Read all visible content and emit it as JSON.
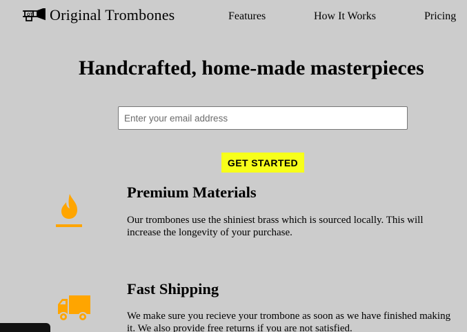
{
  "header": {
    "logo_text": "Original Trombones",
    "logo_icon": "trombone-icon",
    "nav": [
      {
        "label": "Features"
      },
      {
        "label": "How It Works"
      },
      {
        "label": "Pricing"
      }
    ]
  },
  "hero": {
    "title": "Handcrafted, home-made masterpieces",
    "email_placeholder": "Enter your email address",
    "cta_label": "GET STARTED"
  },
  "features": [
    {
      "icon": "fire-icon",
      "title": "Premium Materials",
      "description": "Our trombones use the shiniest brass which is sourced locally. This will increase the longevity of your purchase."
    },
    {
      "icon": "truck-icon",
      "title": "Fast Shipping",
      "description": "We make sure you recieve your trombone as soon as we have finished making it. We also provide free returns if you are not satisfied."
    }
  ],
  "colors": {
    "background": "#cccccc",
    "accent_orange": "#ffa500",
    "cta_yellow": "#f7ff1a"
  }
}
